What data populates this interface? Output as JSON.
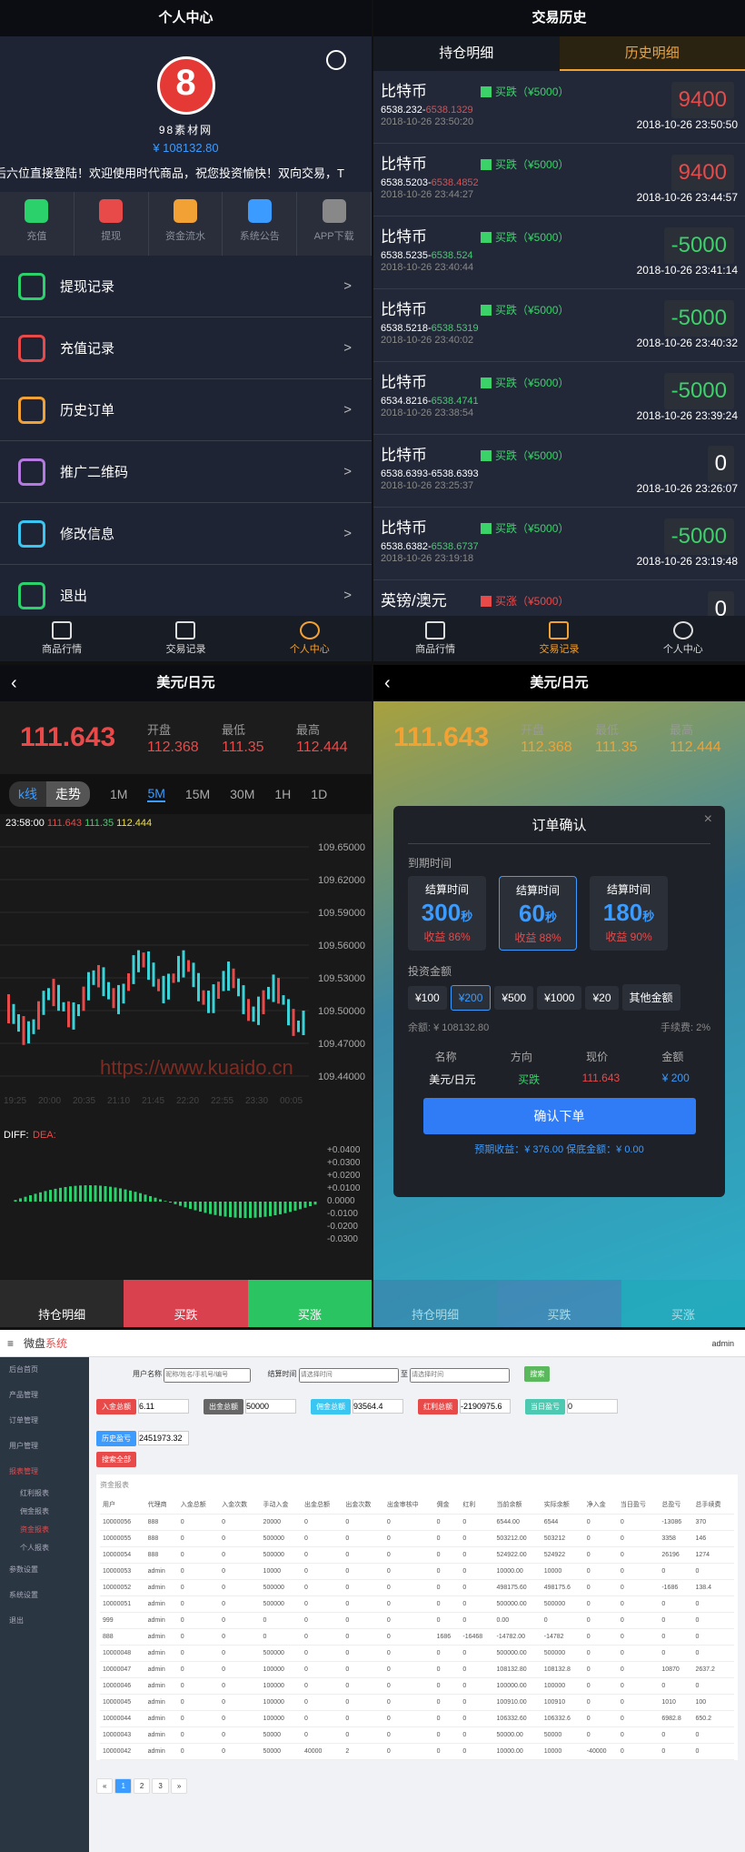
{
  "user_center": {
    "title": "个人中心",
    "username": "98素材网",
    "balance": "¥ 108132.80",
    "marquee": "后六位直接登陆！欢迎使用时代商品，祝您投资愉快！双向交易，T",
    "quick": [
      {
        "label": "充值",
        "color": "#2bd16b"
      },
      {
        "label": "提现",
        "color": "#e84a4a"
      },
      {
        "label": "资金流水",
        "color": "#f2a134"
      },
      {
        "label": "系统公告",
        "color": "#3b9bff"
      },
      {
        "label": "APP下载",
        "color": "#888888"
      }
    ],
    "menu": [
      {
        "label": "提现记录",
        "color": "#2bd16b"
      },
      {
        "label": "充值记录",
        "color": "#e84a4a"
      },
      {
        "label": "历史订单",
        "color": "#f2a134"
      },
      {
        "label": "推广二维码",
        "color": "#b47ae0"
      },
      {
        "label": "修改信息",
        "color": "#3bc6f2"
      },
      {
        "label": "退出",
        "color": "#2bd16b"
      }
    ],
    "arrow": ">"
  },
  "nav": {
    "market": "商品行情",
    "records": "交易记录",
    "me": "个人中心"
  },
  "history": {
    "title": "交易历史",
    "tab_hold": "持仓明细",
    "tab_hist": "历史明细",
    "trades": [
      {
        "name": "比特币",
        "dir": "买跌（¥5000）",
        "dir_up": false,
        "open": "6538.232",
        "close": "6538.1329",
        "close_color": "red",
        "date": "2018-10-26 23:50:20",
        "amt": "9400",
        "amt_color": "red",
        "time": "2018-10-26 23:50:50"
      },
      {
        "name": "比特币",
        "dir": "买跌（¥5000）",
        "dir_up": false,
        "open": "6538.5203",
        "close": "6538.4852",
        "close_color": "red",
        "date": "2018-10-26 23:44:27",
        "amt": "9400",
        "amt_color": "red",
        "time": "2018-10-26 23:44:57"
      },
      {
        "name": "比特币",
        "dir": "买跌（¥5000）",
        "dir_up": false,
        "open": "6538.5235",
        "close": "6538.524",
        "close_color": "green",
        "date": "2018-10-26 23:40:44",
        "amt": "-5000",
        "amt_color": "green",
        "time": "2018-10-26 23:41:14"
      },
      {
        "name": "比特币",
        "dir": "买跌（¥5000）",
        "dir_up": false,
        "open": "6538.5218",
        "close": "6538.5319",
        "close_color": "green",
        "date": "2018-10-26 23:40:02",
        "amt": "-5000",
        "amt_color": "green",
        "time": "2018-10-26 23:40:32"
      },
      {
        "name": "比特币",
        "dir": "买跌（¥5000）",
        "dir_up": false,
        "open": "6534.8216",
        "close": "6538.4741",
        "close_color": "green",
        "date": "2018-10-26 23:38:54",
        "amt": "-5000",
        "amt_color": "green",
        "time": "2018-10-26 23:39:24"
      },
      {
        "name": "比特币",
        "dir": "买跌（¥5000）",
        "dir_up": false,
        "open": "6538.6393",
        "close": "6538.6393",
        "close_color": "white",
        "date": "2018-10-26 23:25:37",
        "amt": "0",
        "amt_color": "white",
        "time": "2018-10-26 23:26:07"
      },
      {
        "name": "比特币",
        "dir": "买跌（¥5000）",
        "dir_up": false,
        "open": "6538.6382",
        "close": "6538.6737",
        "close_color": "green",
        "date": "2018-10-26 23:19:18",
        "amt": "-5000",
        "amt_color": "green",
        "time": "2018-10-26 23:19:48"
      },
      {
        "name": "英镑/澳元",
        "dir": "买涨（¥5000）",
        "dir_up": true,
        "open": "",
        "close": "",
        "close_color": "white",
        "date": "",
        "amt": "0",
        "amt_color": "white",
        "time": ""
      }
    ]
  },
  "quote": {
    "title": "美元/日元",
    "price": "111.643",
    "open_l": "开盘",
    "open": "112.368",
    "low_l": "最低",
    "low": "111.35",
    "high_l": "最高",
    "high": "112.444",
    "periods": [
      "1M",
      "5M",
      "15M",
      "30M",
      "1H",
      "1D"
    ],
    "kline": "k线",
    "trend": "走势",
    "legend_time": "23:58:00",
    "legend_o": "111.643",
    "legend_c": "111.35",
    "legend_h": "112.444",
    "yaxis": [
      "109.65000",
      "109.62000",
      "109.59000",
      "109.56000",
      "109.53000",
      "109.50000",
      "109.47000",
      "109.44000"
    ],
    "xaxis": [
      "19:25",
      "20:00",
      "20:35",
      "21:10",
      "21:45",
      "22:20",
      "22:55",
      "23:30",
      "00:05"
    ],
    "macd_label": "DIFF:",
    "dea_label": "DEA:",
    "macd_axis": [
      "+0.0400",
      "+0.0300",
      "+0.0200",
      "+0.0100",
      "0.0000",
      "-0.0100",
      "-0.0200",
      "-0.0300"
    ],
    "watermark": "https://www.kuaido.cn",
    "btn_hold": "持仓明细",
    "btn_down": "买跌",
    "btn_up": "买涨"
  },
  "order": {
    "title": "订单确认",
    "expire_label": "到期时间",
    "settle": "结算时间",
    "unit": "秒",
    "options": [
      {
        "sec": "300",
        "profit": "收益 86%"
      },
      {
        "sec": "60",
        "profit": "收益 88%"
      },
      {
        "sec": "180",
        "profit": "收益 90%"
      }
    ],
    "invest_label": "投资金额",
    "amounts": [
      "¥100",
      "¥200",
      "¥500",
      "¥1000",
      "¥20"
    ],
    "other": "其他金额",
    "balance": "余额: ¥ 108132.80",
    "fee": "手续费: 2%",
    "h_name": "名称",
    "h_dir": "方向",
    "h_price": "现价",
    "h_amt": "金额",
    "v_name": "美元/日元",
    "v_dir": "买跌",
    "v_price": "111.643",
    "v_amt": "¥ 200",
    "confirm": "确认下单",
    "expect": "预期收益：¥ 376.00",
    "guarantee": "保底金额：¥ 0.00"
  },
  "admin": {
    "brand": "微盘",
    "brand2": "系统",
    "user": "admin",
    "side": [
      "后台首页",
      "产品管理",
      "订单管理",
      "用户管理",
      "报表管理",
      "红利报表",
      "佣金报表",
      "资金报表",
      "个人报表",
      "参数设置",
      "系统设置",
      "退出"
    ],
    "f_name": "用户名称",
    "f_name_ph": "昵称/姓名/手机号/编号",
    "f_time": "结算时间",
    "f_time_ph": "请选择时间",
    "f_to": "至",
    "search": "搜索",
    "stats": [
      {
        "label": "入金总额",
        "val": "6.11",
        "color": "#e84a4a"
      },
      {
        "label": "出金总额",
        "val": "50000",
        "color": "#666"
      },
      {
        "label": "佣金总额",
        "val": "93564.4",
        "color": "#3bc6f2"
      },
      {
        "label": "红利总额",
        "val": "-2190975.6",
        "color": "#e84a4a"
      },
      {
        "label": "当日盈亏",
        "val": "0",
        "color": "#4cc9b0"
      },
      {
        "label": "历史盈亏",
        "val": "2451973.32",
        "color": "#3b9bff"
      }
    ],
    "export": "搜索全部",
    "table_title": "资金报表",
    "headers": [
      "用户",
      "代理商",
      "入金总额",
      "入金次数",
      "手动入金",
      "出金总额",
      "出金次数",
      "出金审核中",
      "佣金",
      "红利",
      "当前余额",
      "实际余额",
      "净入金",
      "当日盈亏",
      "总盈亏",
      "总手续费"
    ],
    "rows": [
      [
        "10000056",
        "888",
        "0",
        "0",
        "20000",
        "0",
        "0",
        "0",
        "0",
        "0",
        "6544.00",
        "6544",
        "0",
        "0",
        "-13086",
        "370"
      ],
      [
        "10000055",
        "888",
        "0",
        "0",
        "500000",
        "0",
        "0",
        "0",
        "0",
        "0",
        "503212.00",
        "503212",
        "0",
        "0",
        "3358",
        "146"
      ],
      [
        "10000054",
        "888",
        "0",
        "0",
        "500000",
        "0",
        "0",
        "0",
        "0",
        "0",
        "524922.00",
        "524922",
        "0",
        "0",
        "26196",
        "1274"
      ],
      [
        "10000053",
        "admin",
        "0",
        "0",
        "10000",
        "0",
        "0",
        "0",
        "0",
        "0",
        "10000.00",
        "10000",
        "0",
        "0",
        "0",
        "0"
      ],
      [
        "10000052",
        "admin",
        "0",
        "0",
        "500000",
        "0",
        "0",
        "0",
        "0",
        "0",
        "498175.60",
        "498175.6",
        "0",
        "0",
        "-1686",
        "138.4"
      ],
      [
        "10000051",
        "admin",
        "0",
        "0",
        "500000",
        "0",
        "0",
        "0",
        "0",
        "0",
        "500000.00",
        "500000",
        "0",
        "0",
        "0",
        "0"
      ],
      [
        "999",
        "admin",
        "0",
        "0",
        "0",
        "0",
        "0",
        "0",
        "0",
        "0",
        "0.00",
        "0",
        "0",
        "0",
        "0",
        "0"
      ],
      [
        "888",
        "admin",
        "0",
        "0",
        "0",
        "0",
        "0",
        "0",
        "1686",
        "-16468",
        "-14782.00",
        "-14782",
        "0",
        "0",
        "0",
        "0"
      ],
      [
        "10000048",
        "admin",
        "0",
        "0",
        "500000",
        "0",
        "0",
        "0",
        "0",
        "0",
        "500000.00",
        "500000",
        "0",
        "0",
        "0",
        "0"
      ],
      [
        "10000047",
        "admin",
        "0",
        "0",
        "100000",
        "0",
        "0",
        "0",
        "0",
        "0",
        "108132.80",
        "108132.8",
        "0",
        "0",
        "10870",
        "2637.2"
      ],
      [
        "10000046",
        "admin",
        "0",
        "0",
        "100000",
        "0",
        "0",
        "0",
        "0",
        "0",
        "100000.00",
        "100000",
        "0",
        "0",
        "0",
        "0"
      ],
      [
        "10000045",
        "admin",
        "0",
        "0",
        "100000",
        "0",
        "0",
        "0",
        "0",
        "0",
        "100910.00",
        "100910",
        "0",
        "0",
        "1010",
        "100"
      ],
      [
        "10000044",
        "admin",
        "0",
        "0",
        "100000",
        "0",
        "0",
        "0",
        "0",
        "0",
        "106332.60",
        "106332.6",
        "0",
        "0",
        "6982.8",
        "650.2"
      ],
      [
        "10000043",
        "admin",
        "0",
        "0",
        "50000",
        "0",
        "0",
        "0",
        "0",
        "0",
        "50000.00",
        "50000",
        "0",
        "0",
        "0",
        "0"
      ],
      [
        "10000042",
        "admin",
        "0",
        "0",
        "50000",
        "40000",
        "2",
        "0",
        "0",
        "0",
        "10000.00",
        "10000",
        "-40000",
        "0",
        "0",
        "0"
      ]
    ],
    "pages": [
      "«",
      "1",
      "2",
      "3",
      "»"
    ]
  }
}
